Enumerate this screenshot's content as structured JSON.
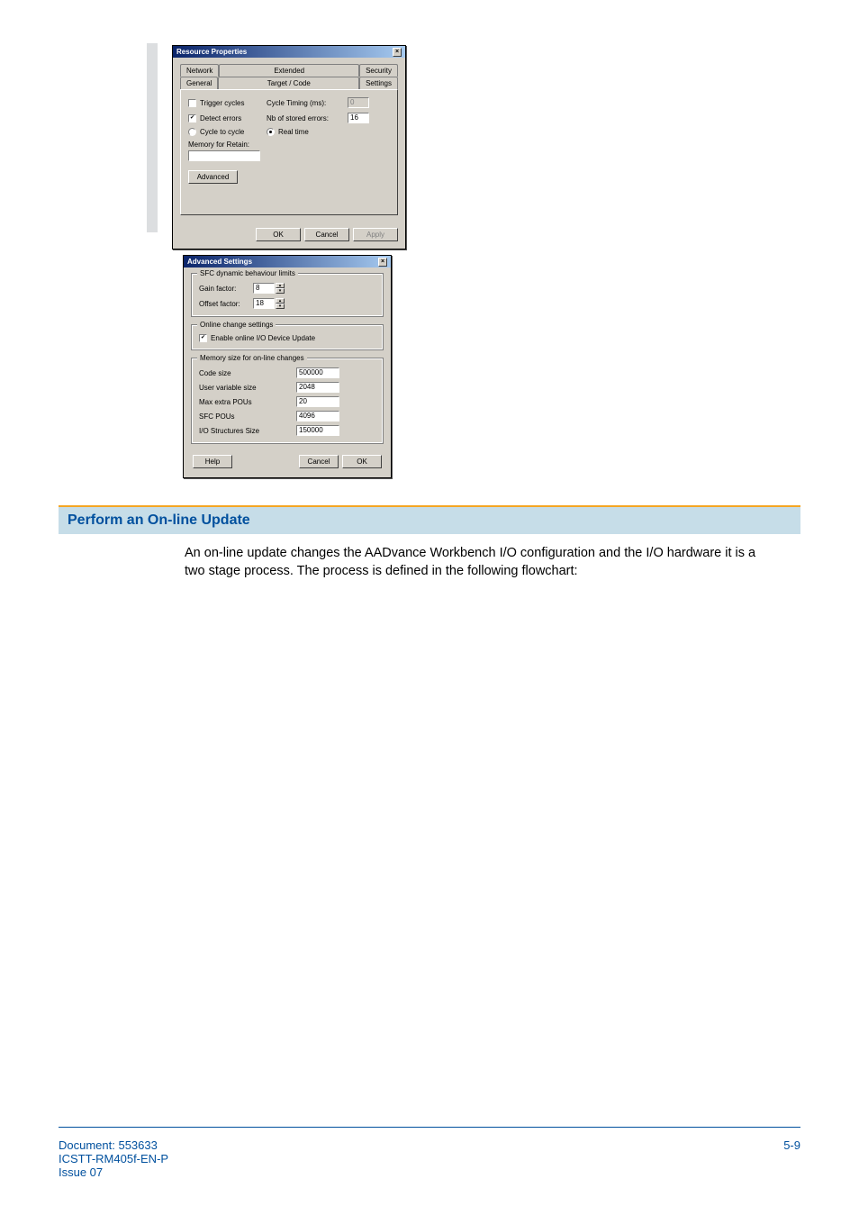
{
  "dialog1": {
    "title": "Resource Properties",
    "tabs": {
      "back_row": [
        "Network",
        "Extended",
        "Security"
      ],
      "front_row": [
        "General",
        "Target / Code",
        "Settings"
      ]
    },
    "trigger_cycles_label": "Trigger cycles",
    "cycle_timing_label": "Cycle Timing (ms):",
    "cycle_timing_value": "0",
    "detect_errors_label": "Detect errors",
    "nb_stored_errors_label": "Nb of stored errors:",
    "nb_stored_errors_value": "16",
    "cycle_to_cycle_label": "Cycle to cycle",
    "real_time_label": "Real time",
    "memory_retain_label": "Memory for Retain:",
    "memory_retain_value": "",
    "advanced_btn": "Advanced",
    "ok_btn": "OK",
    "cancel_btn": "Cancel",
    "apply_btn": "Apply"
  },
  "dialog2": {
    "title": "Advanced Settings",
    "group_sfc": "SFC dynamic behaviour limits",
    "gain_factor_label": "Gain factor:",
    "gain_factor_value": "8",
    "offset_factor_label": "Offset factor:",
    "offset_factor_value": "18",
    "group_online": "Online change settings",
    "enable_online_label": "Enable online I/O Device Update",
    "group_memory": "Memory size for on-line changes",
    "code_size_label": "Code size",
    "code_size_value": "500000",
    "user_var_label": "User variable size",
    "user_var_value": "2048",
    "max_pous_label": "Max extra POUs",
    "max_pous_value": "20",
    "sfc_pous_label": "SFC POUs",
    "sfc_pous_value": "4096",
    "io_struct_label": "I/O Structures Size",
    "io_struct_value": "150000",
    "help_btn": "Help",
    "cancel_btn": "Cancel",
    "ok_btn": "OK"
  },
  "section_heading": "Perform an On-line Update",
  "paragraph": "An on-line update changes the AADvance Workbench I/O configuration and the I/O hardware it is a two stage process. The process is defined in the following flowchart:",
  "footer": {
    "doc_line1": "Document: 553633",
    "doc_line2": "ICSTT-RM405f-EN-P",
    "doc_line3": "Issue 07",
    "page_no": "5-9"
  }
}
